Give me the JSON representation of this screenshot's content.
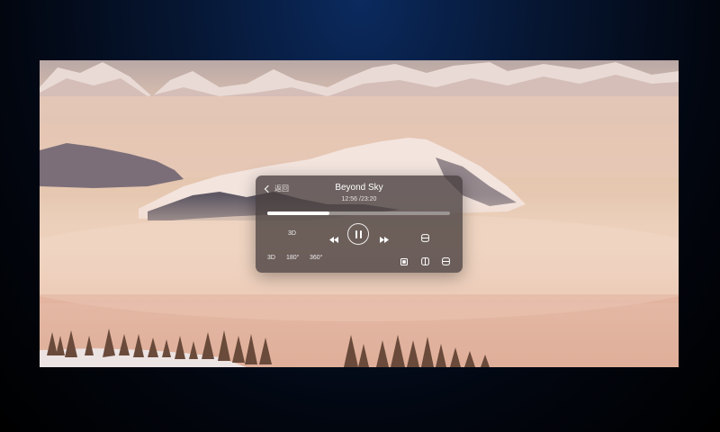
{
  "player": {
    "back_label": "返回",
    "title": "Beyond Sky",
    "time_display": "12:56 /23:20",
    "progress_fraction": 0.34,
    "controls": {
      "mode_3d_label": "3D",
      "prev_icon": "rewind-icon",
      "play_pause_icon": "pause-icon",
      "next_icon": "fast-forward-icon",
      "view_icon": "split-horizontal-icon"
    },
    "modes": {
      "mode_3d": "3D",
      "mode_180": "180°",
      "mode_360": "360°",
      "icons": [
        "square-frame-icon",
        "split-vertical-icon",
        "split-horizontal-icon"
      ]
    }
  },
  "colors": {
    "panel_bg": "rgba(70,62,62,0.78)",
    "progress_fill": "#ffffff",
    "progress_track": "#9a9493"
  }
}
